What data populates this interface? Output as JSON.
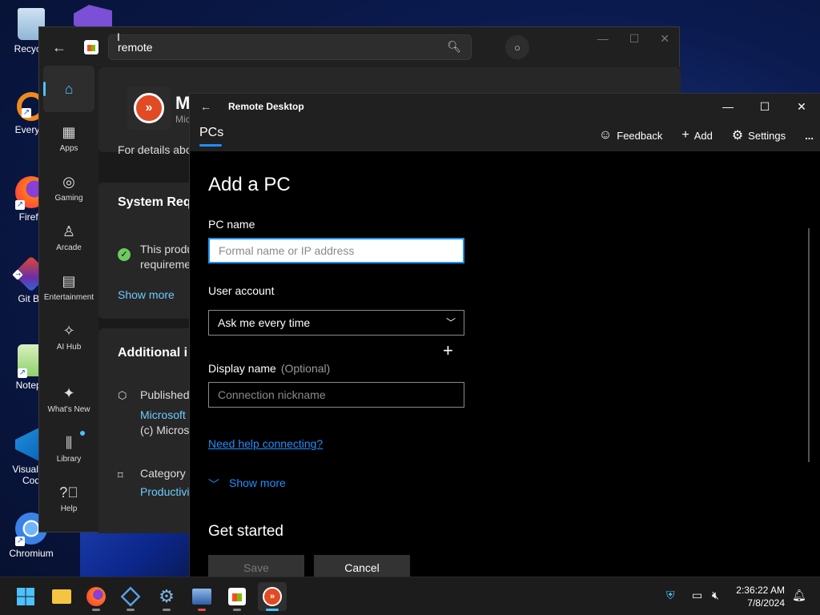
{
  "desktop": {
    "icons": [
      {
        "label": "Recycle",
        "icon": "recycle-bin-icon"
      },
      {
        "label": "Everyth",
        "icon": "everything-icon"
      },
      {
        "label": "Firefo",
        "icon": "firefox-icon"
      },
      {
        "label": "Git Ba",
        "icon": "git-bash-icon"
      },
      {
        "label": "Notepa",
        "icon": "notepad-icon"
      },
      {
        "label": "Visual St Cod",
        "icon": "vscode-icon"
      },
      {
        "label": "Chromium",
        "icon": "chromium-icon"
      }
    ]
  },
  "store": {
    "search_value": "remote",
    "nav": [
      {
        "label": "",
        "icon": "home-icon",
        "active": true
      },
      {
        "label": "Apps",
        "icon": "apps-icon"
      },
      {
        "label": "Gaming",
        "icon": "gaming-icon"
      },
      {
        "label": "Arcade",
        "icon": "arcade-icon"
      },
      {
        "label": "Entertainment",
        "icon": "entertainment-icon"
      },
      {
        "label": "AI Hub",
        "icon": "ai-hub-icon"
      },
      {
        "label": "What's New",
        "icon": "whats-new-icon"
      },
      {
        "label": "Library",
        "icon": "library-icon"
      },
      {
        "label": "Help",
        "icon": "help-icon"
      }
    ],
    "app_title": "M",
    "app_publisher": "Mic",
    "details_text": "For details abo",
    "system_req_heading": "System Requ",
    "system_req_text_1": "This produ",
    "system_req_text_2": "requireme",
    "show_more": "Show more",
    "additional_heading": "Additional i",
    "published_label": "Published",
    "publisher_link": "Microsoft",
    "copyright": "(c) Micros",
    "category_label": "Category",
    "category_value": "Productivi"
  },
  "remote_desktop": {
    "title": "Remote Desktop",
    "tab": "PCs",
    "actions": {
      "feedback": "Feedback",
      "add": "Add",
      "settings": "Settings",
      "more": "..."
    },
    "heading": "Add a PC",
    "pc_name_label": "PC name",
    "pc_name_placeholder": "Formal name or IP address",
    "user_account_label": "User account",
    "user_account_value": "Ask me every time",
    "display_name_label": "Display name",
    "display_name_optional": "(Optional)",
    "display_name_placeholder": "Connection nickname",
    "help_link": "Need help connecting?",
    "show_more": "Show more",
    "get_started": "Get started",
    "save": "Save",
    "cancel": "Cancel"
  },
  "taskbar": {
    "time": "2:36:22 AM",
    "date": "7/8/2024",
    "apps": [
      "windows-start-icon",
      "file-explorer-icon",
      "firefox-icon",
      "virtualbox-icon",
      "settings-gear-icon",
      "remote-connection-icon",
      "microsoft-store-icon",
      "remote-desktop-icon"
    ]
  }
}
